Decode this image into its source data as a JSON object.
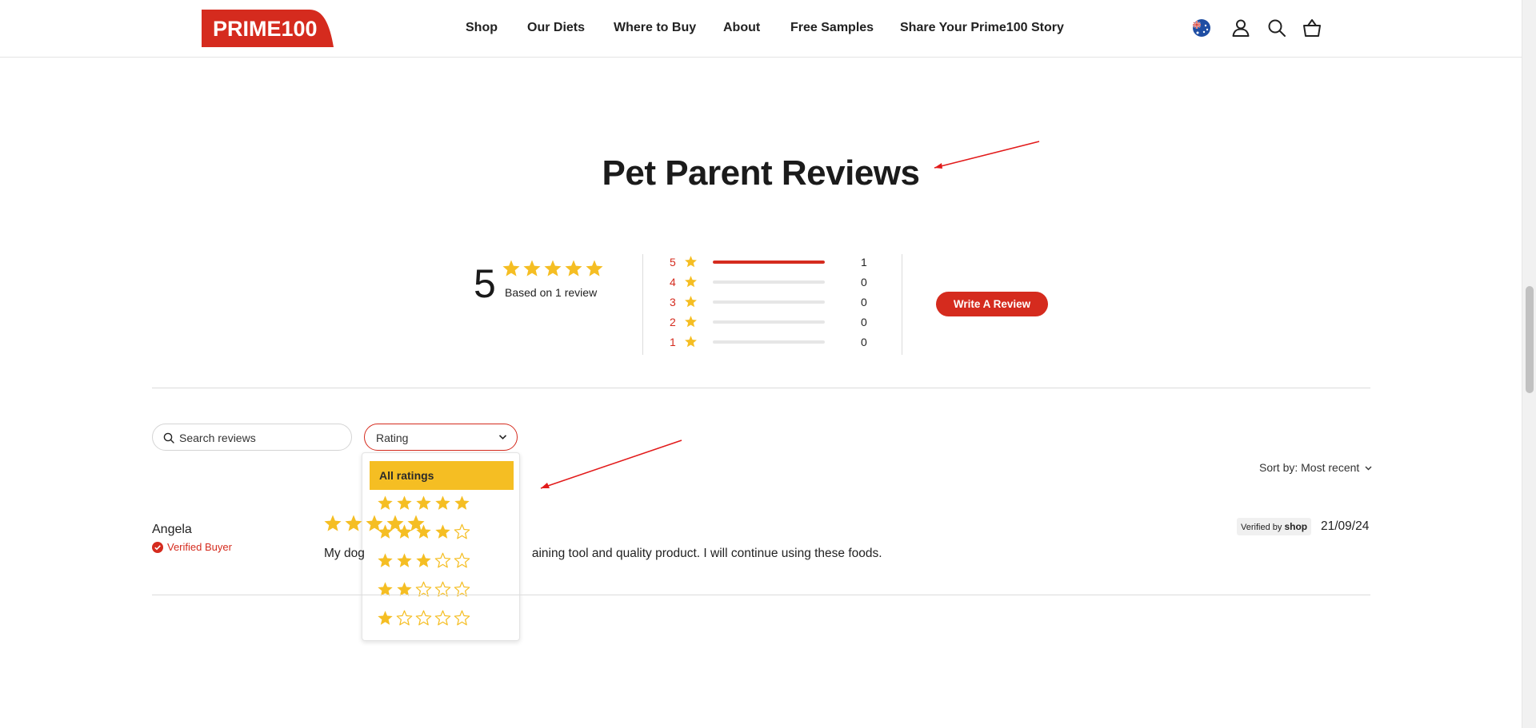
{
  "header": {
    "logo_text": "PRIME100",
    "nav": [
      "Shop",
      "Our Diets",
      "Where to Buy",
      "About",
      "Free Samples",
      "Share Your Prime100 Story"
    ],
    "icons": [
      "australia-flag-icon",
      "account-icon",
      "search-icon",
      "cart-icon"
    ]
  },
  "title": "Pet Parent Reviews",
  "summary": {
    "average": "5",
    "average_stars": 5,
    "based_on": "Based on 1 review",
    "histogram": [
      {
        "stars": "5",
        "count": "1",
        "fraction": 1.0
      },
      {
        "stars": "4",
        "count": "0",
        "fraction": 0
      },
      {
        "stars": "3",
        "count": "0",
        "fraction": 0
      },
      {
        "stars": "2",
        "count": "0",
        "fraction": 0
      },
      {
        "stars": "1",
        "count": "0",
        "fraction": 0
      }
    ],
    "write_review": "Write A Review"
  },
  "filters": {
    "search_placeholder": "Search reviews",
    "rating_label": "Rating",
    "dropdown": {
      "all_label": "All ratings",
      "options": [
        5,
        4,
        3,
        2,
        1
      ]
    },
    "sort_label": "Sort by:",
    "sort_value": "Most recent"
  },
  "review": {
    "author": "Angela",
    "badge": "Verified Buyer",
    "rating": 5,
    "body_prefix": "My dog",
    "body_suffix": "aining tool and quality product. I will continue using these foods.",
    "verified_by": "Verified by",
    "verified_brand": "shop",
    "date": "21/09/24"
  },
  "colors": {
    "brand_red": "#d52b1e",
    "star_gold": "#f5be23",
    "dropdown_highlight": "#f5be23",
    "text_dark": "#1a1a1a"
  }
}
